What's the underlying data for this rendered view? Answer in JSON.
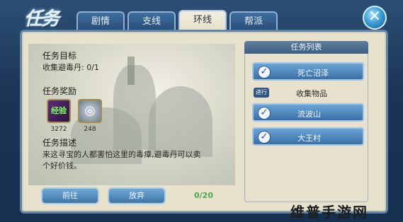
{
  "window": {
    "title_logo": "任务"
  },
  "tabs": [
    {
      "label": "剧情"
    },
    {
      "label": "支线"
    },
    {
      "label": "环线",
      "active": true
    },
    {
      "label": "帮派"
    }
  ],
  "quest": {
    "objective_header": "任务目标",
    "objective_text": "收集避毒丹: 0/1",
    "reward_header": "任务奖励",
    "rewards": [
      {
        "icon": "exp-icon",
        "label": "经验",
        "amount": "3272"
      },
      {
        "icon": "silver-coins-icon",
        "amount": "248"
      }
    ],
    "description_header": "任务描述",
    "description_line1": "来这寻宝的人都害怕这里的毒瘴,避毒丹可以卖",
    "description_line2": "个好价钱。",
    "progress": "0/20"
  },
  "buttons": {
    "go": "前往",
    "abandon": "放弃"
  },
  "quest_list": {
    "title": "任务列表",
    "items": [
      {
        "name": "死亡沼泽"
      },
      {
        "category_icon": "进行",
        "name": "收集物品"
      },
      {
        "name": "流波山"
      },
      {
        "name": "大王村"
      }
    ]
  },
  "watermark": "维普手游网",
  "colors": {
    "tab_active_bg": "#e6dfc8",
    "frame_border": "#5e86ad",
    "progress": "#4aa84a"
  }
}
